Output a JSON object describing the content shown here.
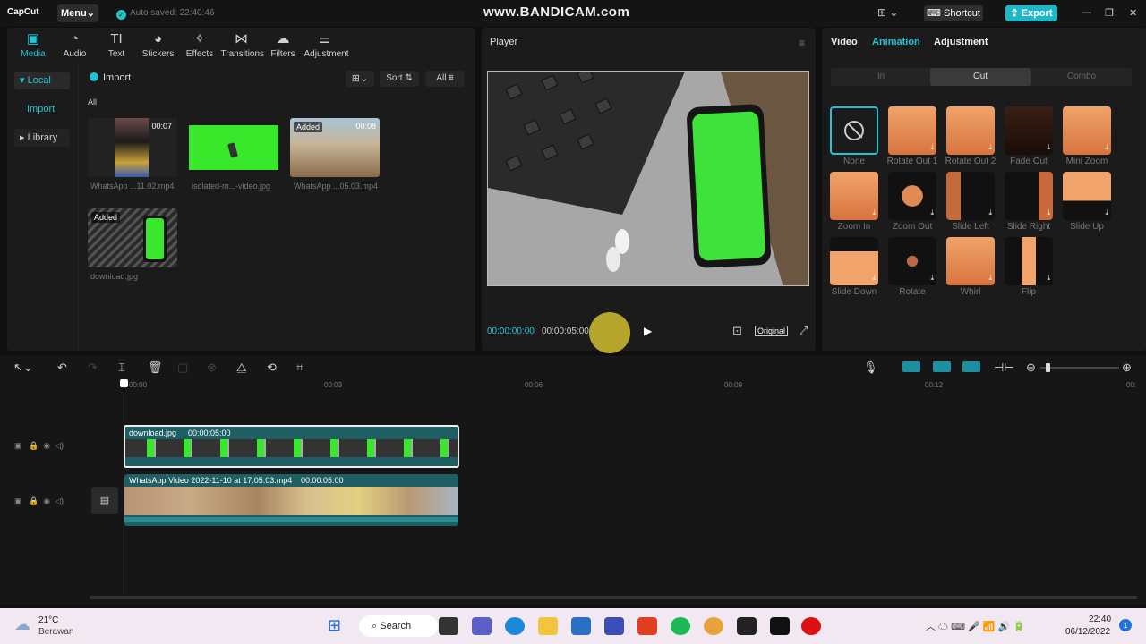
{
  "app": {
    "logo": "CapCut",
    "menu_label": "Menu",
    "autosave": "Auto saved: 22:40:46",
    "watermark": "www.BANDICAM.com",
    "shortcut_label": "Shortcut",
    "export_label": "Export"
  },
  "media_toolbar": [
    {
      "label": "Media",
      "icon": "▣"
    },
    {
      "label": "Audio",
      "icon": "◔"
    },
    {
      "label": "Text",
      "icon": "TI"
    },
    {
      "label": "Stickers",
      "icon": "◕"
    },
    {
      "label": "Effects",
      "icon": "✧"
    },
    {
      "label": "Transitions",
      "icon": "⋈"
    },
    {
      "label": "Filters",
      "icon": "☁"
    },
    {
      "label": "Adjustment",
      "icon": "⚌"
    }
  ],
  "media_side": {
    "local": "Local",
    "import": "Import",
    "library": "Library"
  },
  "media_header": {
    "import_label": "Import",
    "sort_label": "Sort",
    "all_label": "All",
    "section": "All"
  },
  "media_items": [
    {
      "name": "WhatsApp ...11.02.mp4",
      "duration": "00:07",
      "badge": ""
    },
    {
      "name": "isolated-m...-video.jpg",
      "duration": "",
      "badge": ""
    },
    {
      "name": "WhatsApp ...05.03.mp4",
      "duration": "00:08",
      "badge": "Added"
    },
    {
      "name": "download.jpg",
      "duration": "",
      "badge": "Added"
    }
  ],
  "player": {
    "title": "Player",
    "current_time": "00:00:00:00",
    "total_time": "00:00:05:00",
    "original_label": "Original"
  },
  "props": {
    "tabs": [
      "Video",
      "Animation",
      "Adjustment"
    ],
    "segments": [
      "In",
      "Out",
      "Combo"
    ],
    "animations": [
      "None",
      "Rotate Out 1",
      "Rotate Out 2",
      "Fade Out",
      "Mini Zoom",
      "Zoom In",
      "Zoom Out",
      "Slide Left",
      "Slide Right",
      "Slide Up",
      "Slide Down",
      "Rotate",
      "Whirl",
      "Flip"
    ]
  },
  "timeline": {
    "ticks": [
      "00:00",
      "00:03",
      "00:06",
      "00:09",
      "00:12",
      "00:"
    ],
    "clip1": {
      "name": "download.jpg",
      "duration": "00:00:05:00"
    },
    "clip2": {
      "name": "WhatsApp Video 2022-11-10 at 17.05.03.mp4",
      "duration": "00:00:05:00"
    }
  },
  "taskbar": {
    "temp": "21°C",
    "weather": "Berawan",
    "search": "Search",
    "time": "22:40",
    "date": "06/12/2022",
    "notif": "1"
  },
  "colors": {
    "accent": "#22c3d6",
    "green_screen": "#39e82b"
  }
}
